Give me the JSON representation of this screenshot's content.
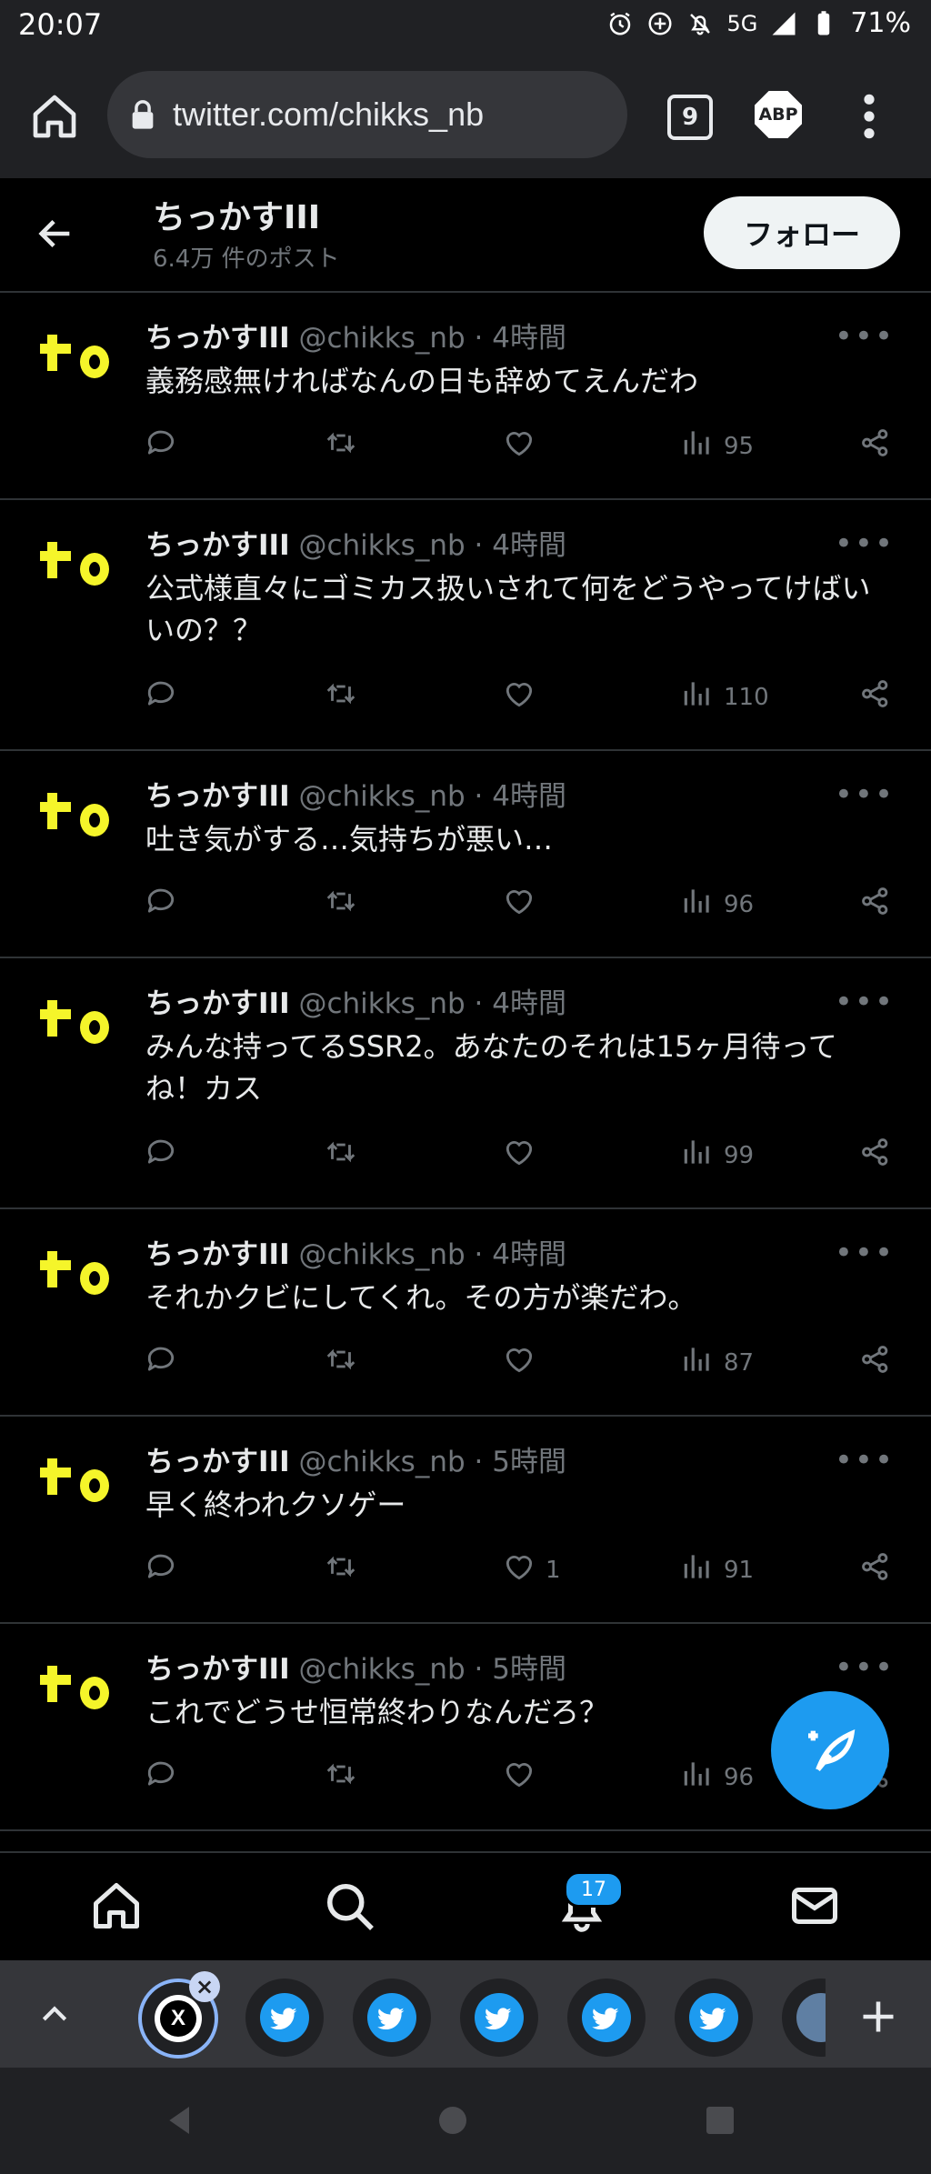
{
  "status_bar": {
    "time": "20:07",
    "network": "5G",
    "battery": "71%"
  },
  "browser": {
    "url": "twitter.com/chikks_nb",
    "tab_count": "9",
    "adblock_label": "ABP"
  },
  "profile": {
    "name": "ちっかすIII",
    "post_count": "6.4万 件のポスト",
    "follow_label": "フォロー"
  },
  "tweets": [
    {
      "name": "ちっかすIII",
      "handle": "@chikks_nb",
      "time": "· 4時間",
      "text": "義務感無ければなんの日も辞めてえんだわ",
      "likes": "",
      "views": "95"
    },
    {
      "name": "ちっかすIII",
      "handle": "@chikks_nb",
      "time": "· 4時間",
      "text": "公式様直々にゴミカス扱いされて何をどうやってけばいいの？？",
      "likes": "",
      "views": "110"
    },
    {
      "name": "ちっかすIII",
      "handle": "@chikks_nb",
      "time": "· 4時間",
      "text": "吐き気がする…気持ちが悪い…",
      "likes": "",
      "views": "96"
    },
    {
      "name": "ちっかすIII",
      "handle": "@chikks_nb",
      "time": "· 4時間",
      "text": "みんな持ってるSSR2。あなたのそれは15ヶ月待ってね！カス",
      "likes": "",
      "views": "99"
    },
    {
      "name": "ちっかすIII",
      "handle": "@chikks_nb",
      "time": "· 4時間",
      "text": "それかクビにしてくれ。その方が楽だわ。",
      "likes": "",
      "views": "87"
    },
    {
      "name": "ちっかすIII",
      "handle": "@chikks_nb",
      "time": "· 5時間",
      "text": "早く終われクソゲー",
      "likes": "1",
      "views": "91"
    },
    {
      "name": "ちっかすIII",
      "handle": "@chikks_nb",
      "time": "· 5時間",
      "text": "これでどうせ恒常終わりなんだろ？",
      "likes": "",
      "views": "96"
    }
  ],
  "bottom_nav": {
    "notification_badge": "17"
  },
  "colors": {
    "accent": "#1d9bf0",
    "avatar_yellow": "#f5f52a"
  }
}
